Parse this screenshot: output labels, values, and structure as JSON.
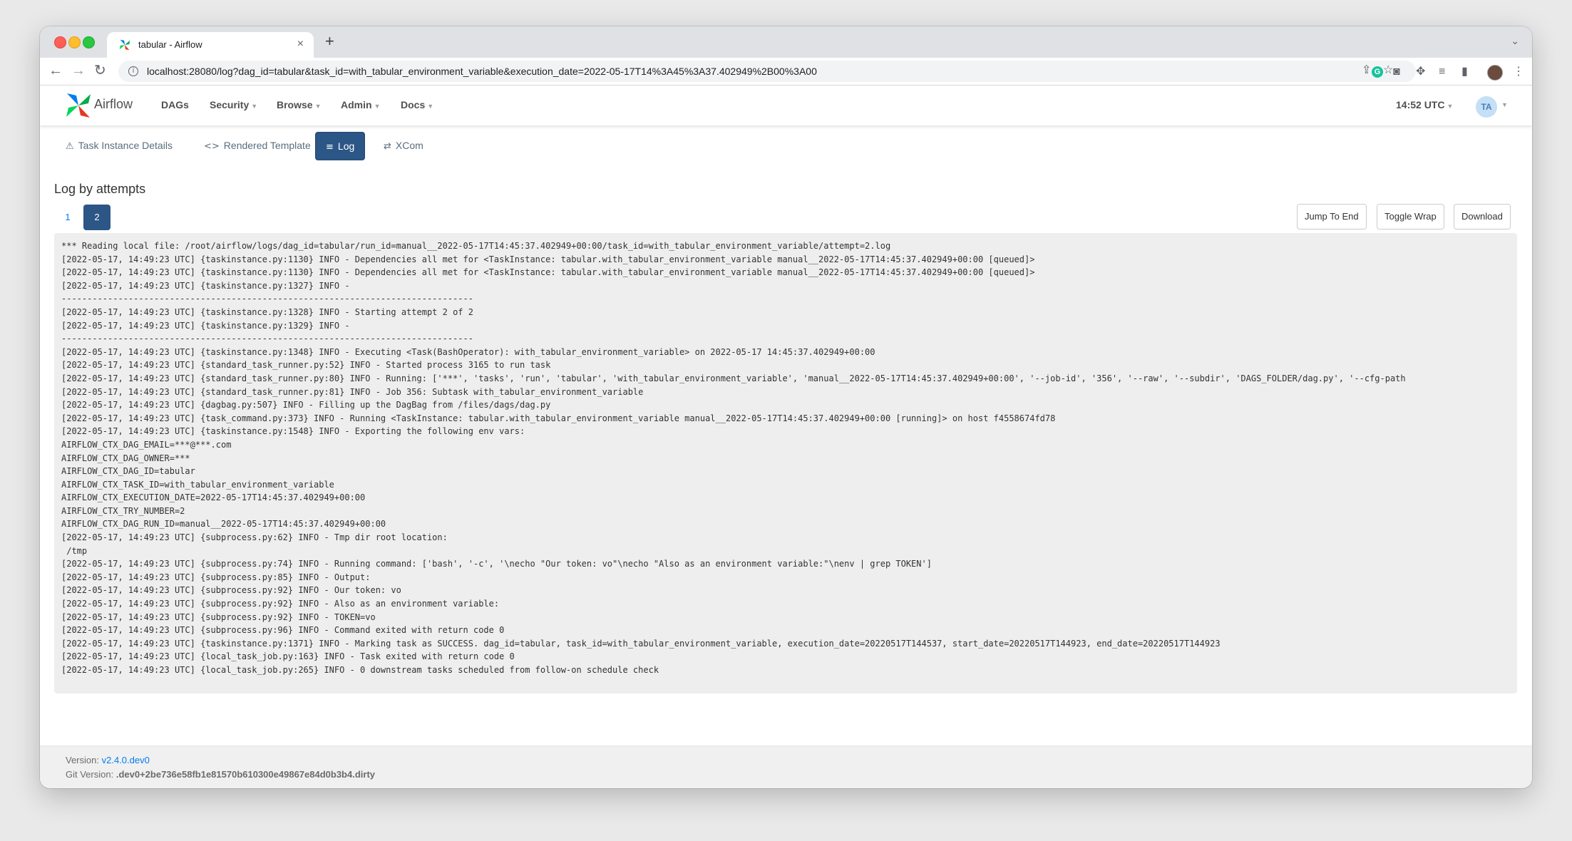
{
  "browser": {
    "tab_title": "tabular - Airflow",
    "tab_close": "×",
    "new_tab": "+",
    "tabs_menu": "⌄",
    "url": "localhost:28080/log?dag_id=tabular&task_id=with_tabular_environment_variable&execution_date=2022-05-17T14%3A45%3A37.402949%2B00%3A00",
    "back": "←",
    "forward": "→",
    "reload": "↻"
  },
  "navbar": {
    "brand": "Airflow",
    "menus": [
      "DAGs",
      "Security",
      "Browse",
      "Admin",
      "Docs"
    ],
    "time": "14:52 UTC",
    "avatar": "TA"
  },
  "subnav": {
    "tabs": [
      "Task Instance Details",
      "Rendered Template",
      "Log",
      "XCom"
    ]
  },
  "log": {
    "heading": "Log by attempts",
    "attempts": [
      "1",
      "2"
    ],
    "buttons": {
      "jump": "Jump To End",
      "wrap": "Toggle Wrap",
      "download": "Download"
    },
    "lines": [
      "*** Reading local file: /root/airflow/logs/dag_id=tabular/run_id=manual__2022-05-17T14:45:37.402949+00:00/task_id=with_tabular_environment_variable/attempt=2.log",
      "[2022-05-17, 14:49:23 UTC] {taskinstance.py:1130} INFO - Dependencies all met for <TaskInstance: tabular.with_tabular_environment_variable manual__2022-05-17T14:45:37.402949+00:00 [queued]>",
      "[2022-05-17, 14:49:23 UTC] {taskinstance.py:1130} INFO - Dependencies all met for <TaskInstance: tabular.with_tabular_environment_variable manual__2022-05-17T14:45:37.402949+00:00 [queued]>",
      "[2022-05-17, 14:49:23 UTC] {taskinstance.py:1327} INFO -",
      "--------------------------------------------------------------------------------",
      "[2022-05-17, 14:49:23 UTC] {taskinstance.py:1328} INFO - Starting attempt 2 of 2",
      "[2022-05-17, 14:49:23 UTC] {taskinstance.py:1329} INFO -",
      "--------------------------------------------------------------------------------",
      "[2022-05-17, 14:49:23 UTC] {taskinstance.py:1348} INFO - Executing <Task(BashOperator): with_tabular_environment_variable> on 2022-05-17 14:45:37.402949+00:00",
      "[2022-05-17, 14:49:23 UTC] {standard_task_runner.py:52} INFO - Started process 3165 to run task",
      "[2022-05-17, 14:49:23 UTC] {standard_task_runner.py:80} INFO - Running: ['***', 'tasks', 'run', 'tabular', 'with_tabular_environment_variable', 'manual__2022-05-17T14:45:37.402949+00:00', '--job-id', '356', '--raw', '--subdir', 'DAGS_FOLDER/dag.py', '--cfg-path",
      "[2022-05-17, 14:49:23 UTC] {standard_task_runner.py:81} INFO - Job 356: Subtask with_tabular_environment_variable",
      "[2022-05-17, 14:49:23 UTC] {dagbag.py:507} INFO - Filling up the DagBag from /files/dags/dag.py",
      "[2022-05-17, 14:49:23 UTC] {task_command.py:373} INFO - Running <TaskInstance: tabular.with_tabular_environment_variable manual__2022-05-17T14:45:37.402949+00:00 [running]> on host f4558674fd78",
      "[2022-05-17, 14:49:23 UTC] {taskinstance.py:1548} INFO - Exporting the following env vars:",
      "AIRFLOW_CTX_DAG_EMAIL=***@***.com",
      "AIRFLOW_CTX_DAG_OWNER=***",
      "AIRFLOW_CTX_DAG_ID=tabular",
      "AIRFLOW_CTX_TASK_ID=with_tabular_environment_variable",
      "AIRFLOW_CTX_EXECUTION_DATE=2022-05-17T14:45:37.402949+00:00",
      "AIRFLOW_CTX_TRY_NUMBER=2",
      "AIRFLOW_CTX_DAG_RUN_ID=manual__2022-05-17T14:45:37.402949+00:00",
      "[2022-05-17, 14:49:23 UTC] {subprocess.py:62} INFO - Tmp dir root location:",
      " /tmp",
      "[2022-05-17, 14:49:23 UTC] {subprocess.py:74} INFO - Running command: ['bash', '-c', '\\necho \"Our token: vo\"\\necho \"Also as an environment variable:\"\\nenv | grep TOKEN']",
      "[2022-05-17, 14:49:23 UTC] {subprocess.py:85} INFO - Output:",
      "[2022-05-17, 14:49:23 UTC] {subprocess.py:92} INFO - Our token: vo",
      "[2022-05-17, 14:49:23 UTC] {subprocess.py:92} INFO - Also as an environment variable:",
      "[2022-05-17, 14:49:23 UTC] {subprocess.py:92} INFO - TOKEN=vo",
      "[2022-05-17, 14:49:23 UTC] {subprocess.py:96} INFO - Command exited with return code 0",
      "[2022-05-17, 14:49:23 UTC] {taskinstance.py:1371} INFO - Marking task as SUCCESS. dag_id=tabular, task_id=with_tabular_environment_variable, execution_date=20220517T144537, start_date=20220517T144923, end_date=20220517T144923",
      "[2022-05-17, 14:49:23 UTC] {local_task_job.py:163} INFO - Task exited with return code 0",
      "[2022-05-17, 14:49:23 UTC] {local_task_job.py:265} INFO - 0 downstream tasks scheduled from follow-on schedule check"
    ]
  },
  "footer": {
    "version_label": "Version:",
    "version_value": "v2.4.0.dev0",
    "git_label": "Git Version:",
    "git_value": ".dev0+2be736e58fb1e81570b610300e49867e84d0b3b4.dirty"
  }
}
